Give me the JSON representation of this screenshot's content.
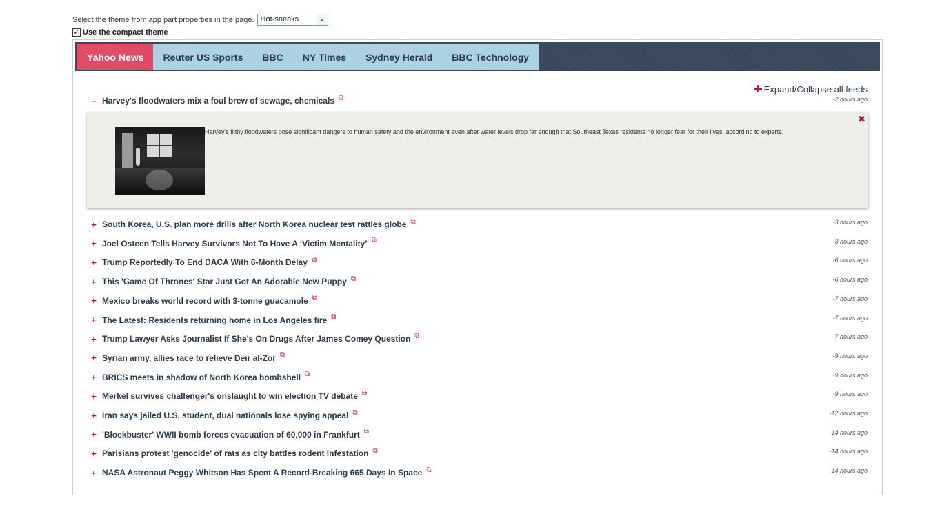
{
  "controls": {
    "theme_label": "Select the theme from app part properties in the page.",
    "theme_value": "Hot-sneaks",
    "compact_label": "Use the compact theme",
    "compact_checked": true
  },
  "tabs": [
    {
      "label": "Yahoo News",
      "active": true
    },
    {
      "label": "Reuter US Sports",
      "active": false
    },
    {
      "label": "BBC",
      "active": false
    },
    {
      "label": "NY Times",
      "active": false
    },
    {
      "label": "Sydney Herald",
      "active": false
    },
    {
      "label": "BBC Technology",
      "active": false
    }
  ],
  "expand_all": {
    "icon": "plus-icon",
    "label": "Expand/Collapse all feeds"
  },
  "expanded_item": {
    "toggle": "−",
    "title": "Harvey's floodwaters mix a foul brew of sewage, chemicals",
    "time": "-2 hours ago",
    "description": "Harvey's filthy floodwaters pose significant dangers to human safety and the environment even after water levels drop far enough that Southeast Texas residents no longer fear for their lives, according to experts.",
    "close": "✖"
  },
  "items": [
    {
      "title": "South Korea, U.S. plan more drills after North Korea nuclear test rattles globe",
      "time": "-3 hours ago"
    },
    {
      "title": "Joel Osteen Tells Harvey Survivors Not To Have A ‘Victim Mentality’",
      "time": "-3 hours ago"
    },
    {
      "title": "Trump Reportedly To End DACA With 6-Month Delay",
      "time": "-6 hours ago"
    },
    {
      "title": "This 'Game Of Thrones' Star Just Got An Adorable New Puppy",
      "time": "-6 hours ago"
    },
    {
      "title": "Mexico breaks world record with 3-tonne guacamole",
      "time": "-7 hours ago"
    },
    {
      "title": "The Latest: Residents returning home in Los Angeles fire",
      "time": "-7 hours ago"
    },
    {
      "title": "Trump Lawyer Asks Journalist If She's On Drugs After James Comey Question",
      "time": "-7 hours ago"
    },
    {
      "title": "Syrian army, allies race to relieve Deir al-Zor",
      "time": "-9 hours ago"
    },
    {
      "title": "BRICS meets in shadow of North Korea bombshell",
      "time": "-9 hours ago"
    },
    {
      "title": "Merkel survives challenger's onslaught to win election TV debate",
      "time": "-9 hours ago"
    },
    {
      "title": "Iran says jailed U.S. student, dual nationals lose spying appeal",
      "time": "-12 hours ago"
    },
    {
      "title": "'Blockbuster' WWII bomb forces evacuation of 60,000 in Frankfurt",
      "time": "-14 hours ago"
    },
    {
      "title": "Parisians protest 'genocide' of rats as city battles rodent infestation",
      "time": "-14 hours ago"
    },
    {
      "title": "NASA Astronaut Peggy Whitson Has Spent A Record-Breaking 665 Days In Space",
      "time": "-14 hours ago"
    }
  ],
  "colors": {
    "accent": "#e0435f",
    "tab_bg": "#a6cfe0",
    "bar_bg": "#34475a",
    "link_icon": "#b0144a"
  },
  "icons": {
    "external_link": "external-link-icon",
    "toggle_plus": "plus-icon",
    "toggle_minus": "minus-icon",
    "close": "close-icon"
  }
}
